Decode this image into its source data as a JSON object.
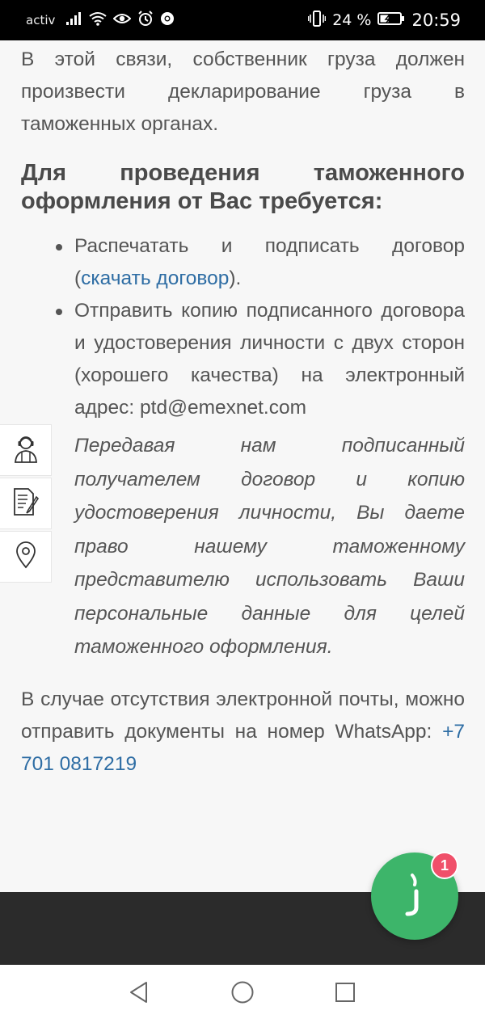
{
  "status_bar": {
    "carrier": "activ",
    "battery": "24 %",
    "time": "20:59",
    "icons": [
      "signal-icon",
      "wifi-icon",
      "eye-icon",
      "alarm-icon",
      "chrome-icon",
      "vibrate-icon",
      "battery-icon"
    ]
  },
  "article": {
    "paragraph1": "В этой связи, собственник груза должен произвести декларирование груза в таможенных органах.",
    "heading": "Для проведения таможенного оформления от Вас требуется:",
    "bullet1_text": "Распечатать и подписать договор (",
    "bullet1_link": "скачать договор",
    "bullet1_end": ").",
    "bullet2_text": "Отправить копию подписанного договора и удостоверения личности с двух сторон (хорошего качества) на электронный адрес: ptd@emexnet.com",
    "note": "Передавая нам подписанный получателем договор и копию удостоверения личности, Вы даете право нашему таможенному представителю использовать Ваши персональные данные для целей таможенного оформления.",
    "last_text": "В случае отсутствия электронной почты, можно отправить документы на номер WhatsApp: ",
    "last_link": "+7 701 0817219"
  },
  "side_menu": {
    "items": [
      "operator-icon",
      "document-icon",
      "location-icon"
    ]
  },
  "chat": {
    "badge_count": "1",
    "color": "#3db56a",
    "badge_color": "#f0506a"
  },
  "nav": {
    "items": [
      "back-icon",
      "home-icon",
      "recents-icon"
    ]
  },
  "colors": {
    "link": "#2e6da4",
    "text": "#555555",
    "footer": "#2b2b2b"
  }
}
